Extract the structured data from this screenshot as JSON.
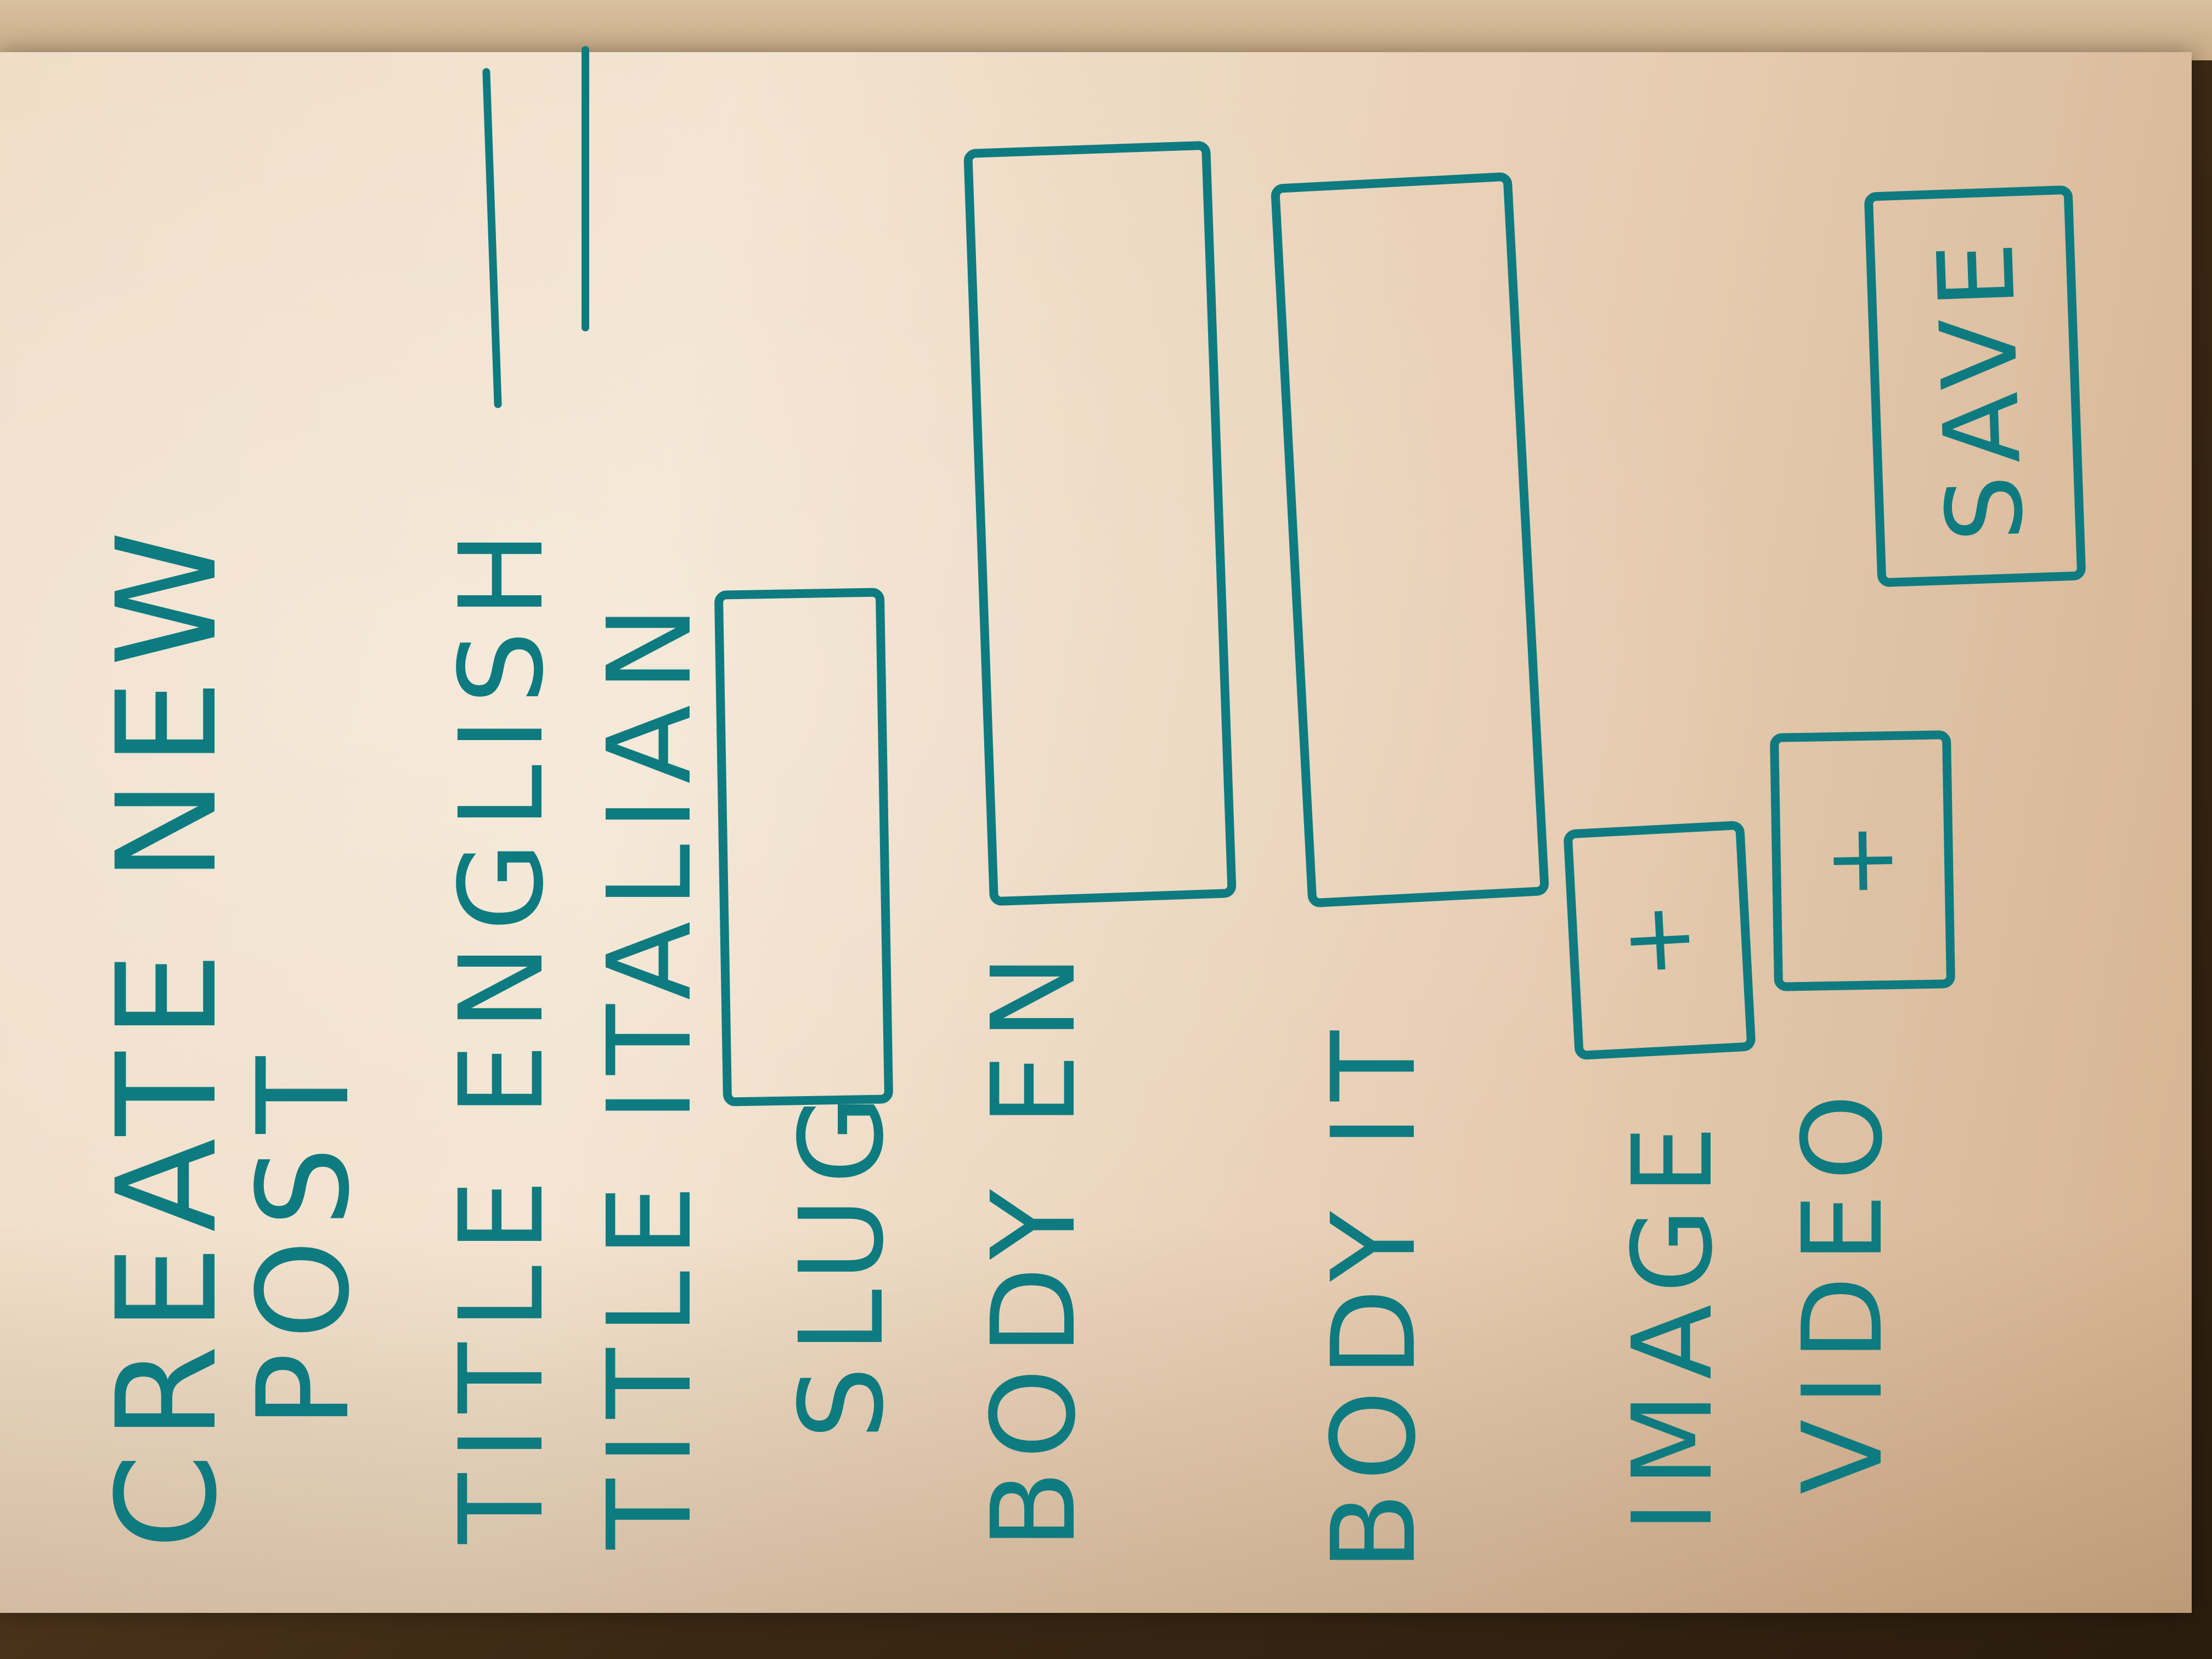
{
  "form": {
    "title_line1": "CREATE NEW",
    "title_line2": "POST",
    "title_english_label": "TITLE ENGLISH",
    "title_italian_label": "TITLE ITALIAN",
    "slug_label": "SLUG",
    "body_en_label": "BODY EN",
    "body_it_label": "BODY IT",
    "image_label": "IMAGE",
    "image_add_icon": "+",
    "video_label": "VIDEO",
    "video_add_icon": "+",
    "save_label": "SAVE"
  },
  "colors": {
    "ink": "#0e7b80",
    "paper": "#f0dcc5"
  }
}
